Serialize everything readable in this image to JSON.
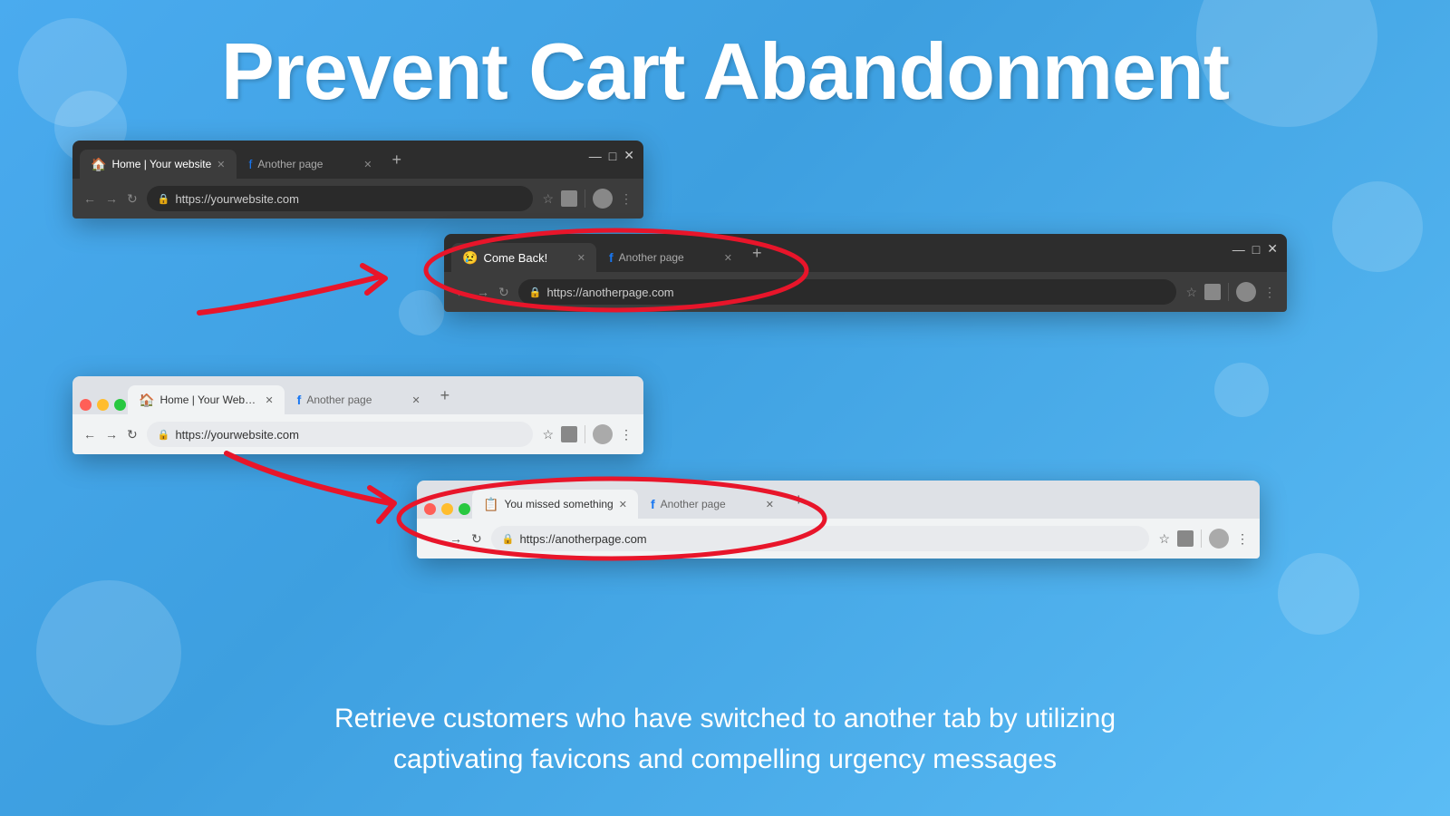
{
  "page": {
    "title": "Prevent Cart Abandonment",
    "description_line1": "Retrieve customers who have switched to another tab by utilizing",
    "description_line2": "captivating favicons and compelling urgency messages"
  },
  "browser_top_dark": {
    "tab1_title": "Home | Your website",
    "tab2_title": "Another page",
    "url": "https://yourwebsite.com",
    "come_back_tab_title": "Come Back!",
    "another_page_tab2": "Another page",
    "url2": "https://anotherpage.com"
  },
  "browser_bottom_light": {
    "tab1_title": "Home | Your Website",
    "tab2_title": "Another page",
    "url": "https://yourwebsite.com",
    "you_missed_tab_title": "You missed something",
    "another_page_tab2": "Another page",
    "url2": "https://anotherpage.com"
  },
  "arrows": {
    "arrow1_label": "arrow pointing right",
    "arrow2_label": "arrow pointing right"
  }
}
